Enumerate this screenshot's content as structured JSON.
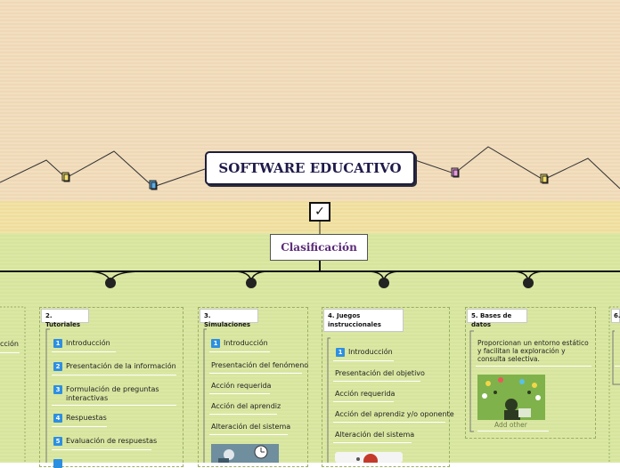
{
  "map": {
    "root": "SOFTWARE EDUCATIVO",
    "check_symbol": "✓",
    "clasificacion": "Clasificación"
  },
  "branches": {
    "partial_left_item": "cción",
    "tutoriales": {
      "title": "2. Tutoriales",
      "items": [
        {
          "num": "1",
          "text": "Introducción"
        },
        {
          "num": "2",
          "text": "Presentación de la información"
        },
        {
          "num": "3",
          "text": "Formulación de preguntas interactivas"
        },
        {
          "num": "4",
          "text": "Respuestas"
        },
        {
          "num": "5",
          "text": "Evaluación de respuestas"
        }
      ]
    },
    "simulaciones": {
      "title": "3. Simulaciones",
      "items": [
        {
          "num": "1",
          "text": "Introducción"
        },
        {
          "text": "Presentación del fenómeno"
        },
        {
          "text": "Acción requerida"
        },
        {
          "text": "Acción del aprendiz"
        },
        {
          "text": "Alteración del sistema"
        }
      ]
    },
    "juegos": {
      "title": "4. Juegos instruccionales",
      "items": [
        {
          "num": "1",
          "text": "Introducción"
        },
        {
          "text": "Presentación del objetivo"
        },
        {
          "text": "Acción requerida"
        },
        {
          "text": "Acción del aprendiz y/o oponente"
        },
        {
          "text": "Alteración del sistema"
        }
      ]
    },
    "bases": {
      "title": "5. Bases de datos",
      "note": "Proporcionan un entorno estático y facilitan la exploración y consulta selectiva.",
      "add_other": "Add other"
    },
    "sixth": {
      "title": "6."
    }
  },
  "colors": {
    "top_bg": "#f2dfc0",
    "band_bg": "#f2e3a8",
    "bottom_bg": "#dbe8a4",
    "root_text": "#1f1a4a",
    "clasif_text": "#5a2a78",
    "number_badge": "#2d8fe0"
  }
}
